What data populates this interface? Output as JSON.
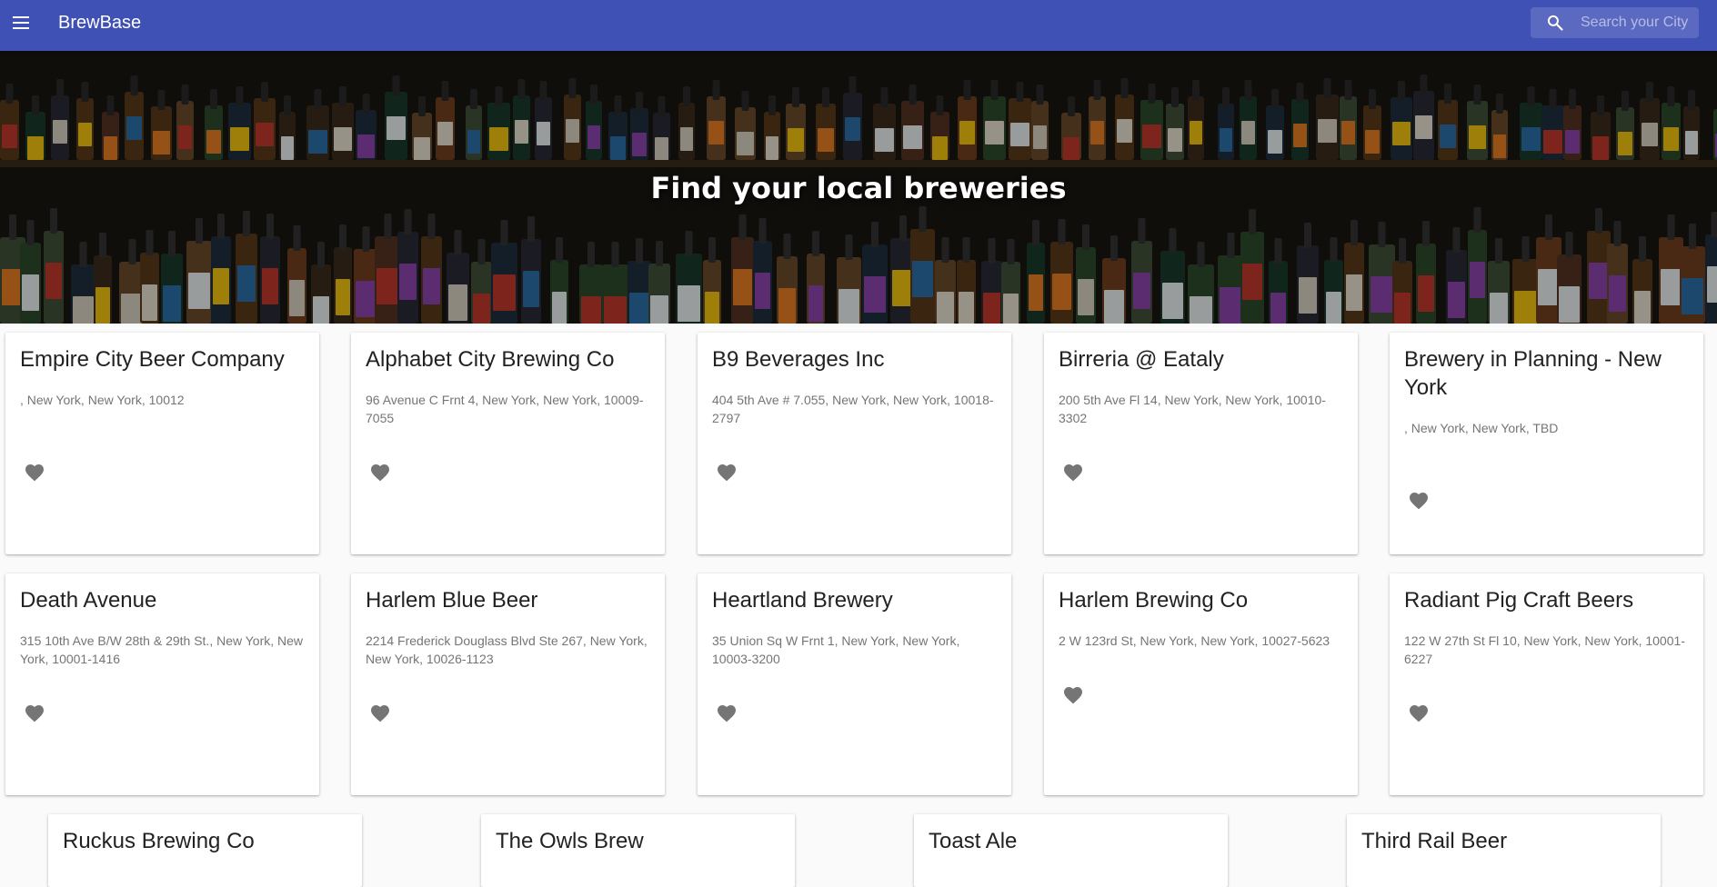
{
  "app": {
    "title": "BrewBase",
    "search_placeholder": "Search your City"
  },
  "hero": {
    "title": "Find your local breweries"
  },
  "breweries": [
    {
      "name": "Empire City Beer Company",
      "address": ", New York, New York, 10012"
    },
    {
      "name": "Alphabet City Brewing Co",
      "address": "96 Avenue C Frnt 4, New York, New York, 10009-7055"
    },
    {
      "name": "B9 Beverages Inc",
      "address": "404 5th Ave # 7.055, New York, New York, 10018-2797"
    },
    {
      "name": "Birreria @ Eataly",
      "address": "200 5th Ave Fl 14, New York, New York, 10010-3302"
    },
    {
      "name": "Brewery in Planning - New York",
      "address": ", New York, New York, TBD"
    },
    {
      "name": "Death Avenue",
      "address": "315 10th Ave B/W 28th & 29th St., New York, New York, 10001-1416"
    },
    {
      "name": "Harlem Blue Beer",
      "address": "2214 Frederick Douglass Blvd Ste 267, New York, New York, 10026-1123"
    },
    {
      "name": "Heartland Brewery",
      "address": "35 Union Sq W Frnt 1, New York, New York, 10003-3200"
    },
    {
      "name": "Harlem Brewing Co",
      "address": "2 W 123rd St, New York, New York, 10027-5623"
    },
    {
      "name": "Radiant Pig Craft Beers",
      "address": "122 W 27th St Fl 10, New York, New York, 10001-6227"
    },
    {
      "name": "Ruckus Brewing Co",
      "address": ""
    },
    {
      "name": "The Owls Brew",
      "address": ""
    },
    {
      "name": "Toast Ale",
      "address": ""
    },
    {
      "name": "Third Rail Beer",
      "address": ""
    }
  ],
  "colors": {
    "primary": "#3f51b5",
    "favorite_icon": "#757575"
  },
  "icons": {
    "menu": "menu-icon",
    "search": "search-icon",
    "favorite": "heart-icon"
  }
}
